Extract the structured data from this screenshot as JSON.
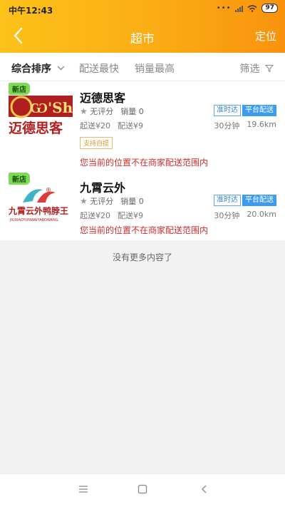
{
  "status_bar": {
    "time": "中午12:43",
    "battery": "97"
  },
  "navbar": {
    "title": "超市",
    "action": "定位"
  },
  "sort": {
    "items": [
      "综合排序",
      "配送最快",
      "销量最高"
    ],
    "filter": "筛选"
  },
  "shops": [
    {
      "badge": "新店",
      "name": "迈德思客",
      "rating": "无评分",
      "sales": "销量 0",
      "tags": [
        "准时达",
        "平台配送"
      ],
      "min_order": "起送¥20",
      "delivery_fee": "配送¥9",
      "time": "30分钟",
      "distance": "19.6km",
      "pickup": "支持自提",
      "warning": "您当前的位置不在商家配送范围内",
      "logo_lines": [
        "Ѡ'Sh",
        "迈德思客"
      ]
    },
    {
      "badge": "新店",
      "name": "九霄云外",
      "rating": "无评分",
      "sales": "销量 0",
      "tags": [
        "准时达",
        "平台配送"
      ],
      "min_order": "起送¥20",
      "delivery_fee": "配送¥9",
      "time": "30分钟",
      "distance": "20.0km",
      "warning": "您当前的位置不在商家配送范围内",
      "logo_lines": [
        "九霄云外鸭脖王",
        "JIUXIAOYUNWAIYABOWANG"
      ]
    }
  ],
  "footer_text": "没有更多内容了"
}
